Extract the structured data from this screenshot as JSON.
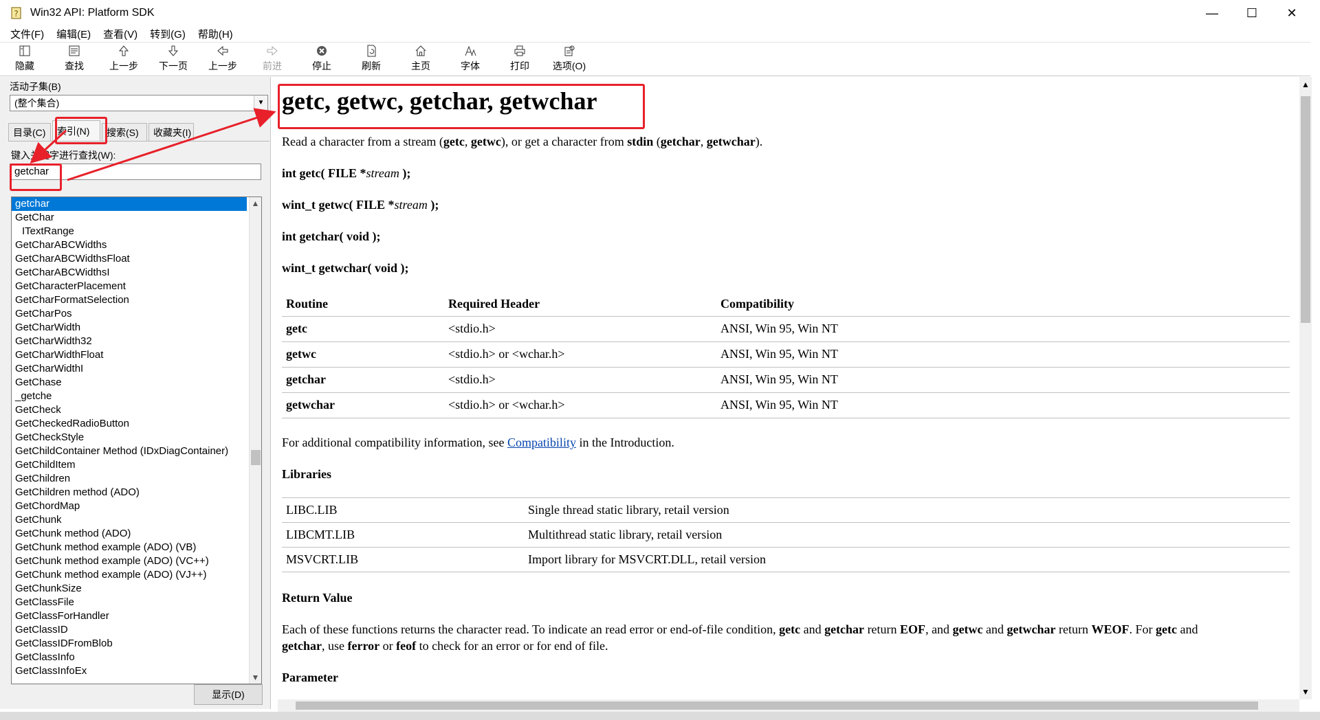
{
  "window": {
    "title": "Win32 API: Platform SDK",
    "minimize": "—",
    "maximize": "☐",
    "close": "✕"
  },
  "menu": [
    "文件(F)",
    "编辑(E)",
    "查看(V)",
    "转到(G)",
    "帮助(H)"
  ],
  "toolbar": [
    {
      "label": "隐藏",
      "icon": "hide-icon",
      "enabled": true
    },
    {
      "label": "查找",
      "icon": "locate-icon",
      "enabled": true
    },
    {
      "label": "上一步",
      "icon": "up-arrow-icon",
      "enabled": true
    },
    {
      "label": "下一页",
      "icon": "down-arrow-icon",
      "enabled": true
    },
    {
      "label": "上一步",
      "icon": "back-arrow-icon",
      "enabled": true
    },
    {
      "label": "前进",
      "icon": "forward-arrow-icon",
      "enabled": false
    },
    {
      "label": "停止",
      "icon": "stop-icon",
      "enabled": true
    },
    {
      "label": "刷新",
      "icon": "refresh-icon",
      "enabled": true
    },
    {
      "label": "主页",
      "icon": "home-icon",
      "enabled": true
    },
    {
      "label": "字体",
      "icon": "font-icon",
      "enabled": true
    },
    {
      "label": "打印",
      "icon": "print-icon",
      "enabled": true
    },
    {
      "label": "选项(O)",
      "icon": "options-icon",
      "enabled": true
    }
  ],
  "left": {
    "subset_label": "活动子集(B)",
    "subset_value": "(整个集合)",
    "tabs": [
      "目录(C)",
      "索引(N)",
      "搜索(S)",
      "收藏夹(I)"
    ],
    "active_tab": "索引(N)",
    "search_label": "键入关键字进行查找(W):",
    "search_value": "getchar",
    "index_items": [
      "getchar",
      "GetChar",
      "ITextRange",
      "GetCharABCWidths",
      "GetCharABCWidthsFloat",
      "GetCharABCWidthsI",
      "GetCharacterPlacement",
      "GetCharFormatSelection",
      "GetCharPos",
      "GetCharWidth",
      "GetCharWidth32",
      "GetCharWidthFloat",
      "GetCharWidthI",
      "GetChase",
      "_getche",
      "GetCheck",
      "GetCheckedRadioButton",
      "GetCheckStyle",
      "GetChildContainer Method (IDxDiagContainer)",
      "GetChildItem",
      "GetChildren",
      "GetChildren method (ADO)",
      "GetChordMap",
      "GetChunk",
      "GetChunk method (ADO)",
      "GetChunk method example (ADO) (VB)",
      "GetChunk method example (ADO) (VC++)",
      "GetChunk method example (ADO) (VJ++)",
      "GetChunkSize",
      "GetClassFile",
      "GetClassForHandler",
      "GetClassID",
      "GetClassIDFromBlob",
      "GetClassInfo",
      "GetClassInfoEx"
    ],
    "show_button": "显示(D)"
  },
  "doc": {
    "title": "getc, getwc, getchar, getwchar",
    "intro": {
      "t1": "Read a character from a stream (",
      "b1": "getc",
      "t2": ", ",
      "b2": "getwc",
      "t3": "), or get a character from ",
      "b3": "stdin",
      "t4": " (",
      "b4": "getchar",
      "t5": ", ",
      "b5": "getwchar",
      "t6": ")."
    },
    "sig1": {
      "pre": "int getc( FILE *",
      "arg": "stream",
      "post": " );"
    },
    "sig2": {
      "pre": "wint_t getwc( FILE *",
      "arg": "stream",
      "post": " );"
    },
    "sig3": "int getchar( void );",
    "sig4": "wint_t getwchar( void );",
    "routine_table": {
      "headers": [
        "Routine",
        "Required Header",
        "Compatibility"
      ],
      "rows": [
        [
          "getc",
          "<stdio.h>",
          "ANSI, Win 95, Win NT"
        ],
        [
          "getwc",
          "<stdio.h> or <wchar.h>",
          "ANSI, Win 95, Win NT"
        ],
        [
          "getchar",
          "<stdio.h>",
          "ANSI, Win 95, Win NT"
        ],
        [
          "getwchar",
          "<stdio.h> or <wchar.h>",
          "ANSI, Win 95, Win NT"
        ]
      ]
    },
    "compat": {
      "pre": "For additional compatibility information, see ",
      "link": "Compatibility",
      "post": " in the Introduction."
    },
    "libraries_heading": "Libraries",
    "libraries": [
      [
        "LIBC.LIB",
        "Single thread static library, retail version"
      ],
      [
        "LIBCMT.LIB",
        "Multithread static library, retail version"
      ],
      [
        "MSVCRT.LIB",
        "Import library for MSVCRT.DLL, retail version"
      ]
    ],
    "return_heading": "Return Value",
    "return_text": {
      "t1": "Each of these functions returns the character read. To indicate an read error or end-of-file condition, ",
      "b1": "getc",
      "t2": " and ",
      "b2": "getchar",
      "t3": " return ",
      "b3": "EOF",
      "t4": ", and ",
      "b4": "getwc",
      "t5": " and ",
      "b5": "getwchar",
      "t6": " return ",
      "b6": "WEOF",
      "t7": ". For ",
      "b7": "getc",
      "t8": " and",
      "line2_b1": "getchar",
      "line2_t1": ", use ",
      "line2_b2": "ferror",
      "line2_t2": " or ",
      "line2_b3": "feof",
      "line2_t3": " to check for an error or for end of file."
    },
    "parameter_heading": "Parameter"
  },
  "colors": {
    "selection": "#0078d7",
    "annotation": "#e8202a",
    "link": "#0645ad"
  }
}
